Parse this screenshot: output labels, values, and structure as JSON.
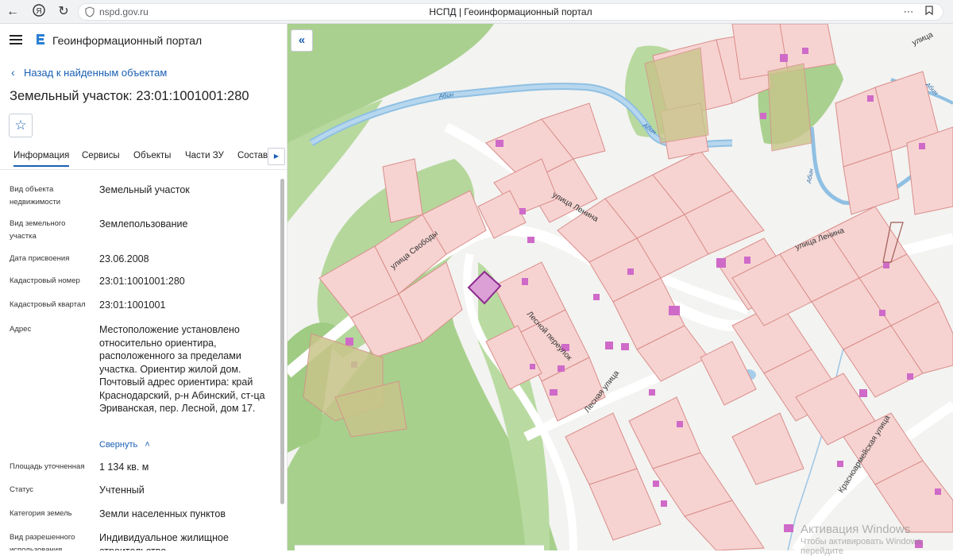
{
  "browser": {
    "url": "nspd.gov.ru",
    "page_title": "НСПД | Геоинформационный портал"
  },
  "header": {
    "portal_name": "Геоинформационный портал"
  },
  "sidebar": {
    "back_link": "Назад к найденным объектам",
    "object_title": "Земельный участок: 23:01:1001001:280",
    "tabs": [
      {
        "label": "Информация",
        "active": true
      },
      {
        "label": "Сервисы"
      },
      {
        "label": "Объекты"
      },
      {
        "label": "Части ЗУ"
      },
      {
        "label": "Состав"
      }
    ],
    "properties": [
      {
        "label": "Вид объекта недвижимости",
        "value": "Земельный участок"
      },
      {
        "label": "Вид земельного участка",
        "value": "Землепользование"
      },
      {
        "label": "Дата присвоения",
        "value": "23.06.2008"
      },
      {
        "label": "Кадастровый номер",
        "value": "23:01:1001001:280"
      },
      {
        "label": "Кадастровый квартал",
        "value": "23:01:1001001"
      },
      {
        "label": "Адрес",
        "value": "Местоположение установлено относительно ориентира, расположенного за пределами участка. Ориентир жилой дом. Почтовый адрес ориентира: край Краснодарский, р-н Абинский, ст-ца Эриванская, пер. Лесной, дом 17."
      },
      {
        "label": "Площадь уточненная",
        "value": "1 134 кв. м"
      },
      {
        "label": "Статус",
        "value": "Учтенный"
      },
      {
        "label": "Категория земель",
        "value": "Земли населенных пунктов"
      },
      {
        "label": "Вид разрешенного использования",
        "value": "Индивидуальное жилищное строительство"
      }
    ],
    "collapse_label": "Свернуть"
  },
  "map": {
    "streets": {
      "lenina_1": "улица Ленина",
      "lenina_2": "улица Ленина",
      "svobody": "улица Свободы",
      "lesnoy": "Лесной переулок",
      "lesnaya": "Лесная улица",
      "krasnoarm": "Красноармейская улица",
      "top_right": "улица"
    },
    "rivers": {
      "abin_1": "Абин",
      "abin_2": "Абин",
      "abin_3": "Абин",
      "abin_4": "Абин"
    },
    "colors": {
      "forest": "#a8d08d",
      "parcel_fill": "#f6d3d1",
      "parcel_stroke": "#d98d8a",
      "river": "#9cc6e6",
      "selected": "#8e2a8e"
    }
  },
  "watermark": {
    "line1": "Активация Windows",
    "line2": "Чтобы активировать Windows, перейдите"
  }
}
